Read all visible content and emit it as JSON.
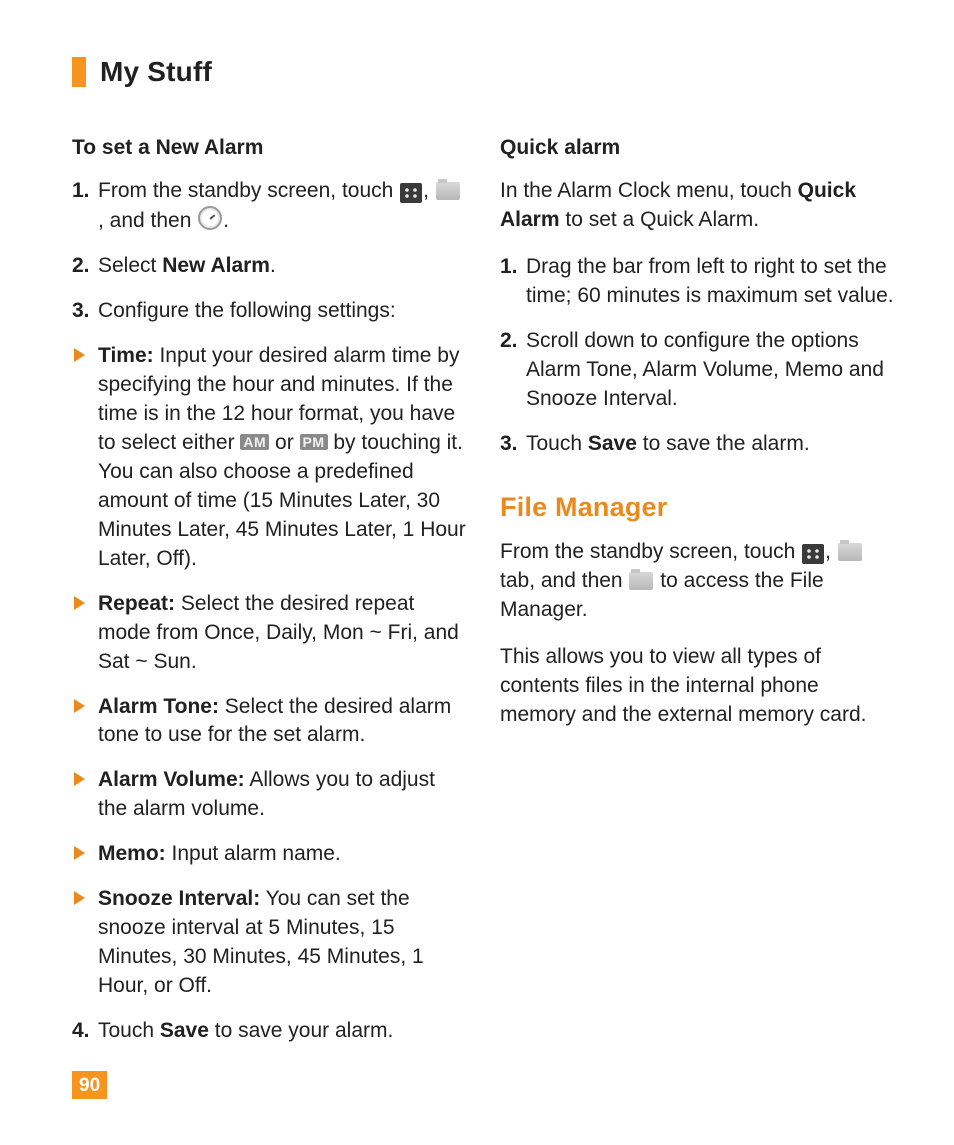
{
  "header": {
    "title": "My Stuff"
  },
  "pageNumber": "90",
  "left": {
    "sub1": "To set a New Alarm",
    "steps": {
      "s1": {
        "num": "1.",
        "a": "From the standby screen, touch ",
        "b": ", ",
        "c": ", and then ",
        "d": "."
      },
      "s2": {
        "num": "2.",
        "a": "Select ",
        "b": "New Alarm",
        "c": "."
      },
      "s3": {
        "num": "3.",
        "a": "Configure the following settings:"
      },
      "s4": {
        "num": "4.",
        "a": "Touch ",
        "b": "Save",
        "c": " to save your alarm."
      }
    },
    "bullets": {
      "time": {
        "label": "Time:",
        "a": " Input your desired alarm time by specifying the hour and minutes. If the time is in the 12 hour format, you have to select either ",
        "am": "AM",
        "b": " or ",
        "pm": "PM",
        "c": " by touching it. You can also choose a predefined amount of time (15 Minutes Later, 30 Minutes Later, 45 Minutes Later, 1 Hour Later, Off)."
      },
      "repeat": {
        "label": "Repeat:",
        "a": " Select the desired repeat mode from Once, Daily, Mon ~ Fri, and Sat ~ Sun."
      },
      "tone": {
        "label": "Alarm Tone:",
        "a": " Select the desired alarm tone to use for the set alarm."
      },
      "volume": {
        "label": "Alarm Volume:",
        "a": " Allows you to adjust the alarm volume."
      },
      "memo": {
        "label": "Memo:",
        "a": " Input alarm name."
      },
      "snooze": {
        "label": "Snooze Interval:",
        "a": " You can set the snooze interval at 5 Minutes, 15 Minutes, 30 Minutes, 45 Minutes, 1 Hour, or Off."
      }
    }
  },
  "right": {
    "sub1": "Quick alarm",
    "intro": {
      "a": "In the Alarm Clock menu, touch ",
      "b": "Quick Alarm",
      "c": " to set a Quick Alarm."
    },
    "steps": {
      "s1": {
        "num": "1.",
        "a": "Drag the bar from left to right to set the time; 60 minutes is maximum set value."
      },
      "s2": {
        "num": "2.",
        "a": "Scroll down to configure the options Alarm Tone, Alarm Volume, Memo and Snooze Interval."
      },
      "s3": {
        "num": "3.",
        "a": "Touch ",
        "b": "Save",
        "c": " to save the alarm."
      }
    },
    "fm": {
      "heading": "File Manager",
      "p1": {
        "a": "From the standby screen, touch ",
        "b": ", ",
        "c": " tab, and then ",
        "d": " to access the File Manager."
      },
      "p2": "This allows you to view all types of contents files in the internal phone memory and the external memory card."
    }
  }
}
